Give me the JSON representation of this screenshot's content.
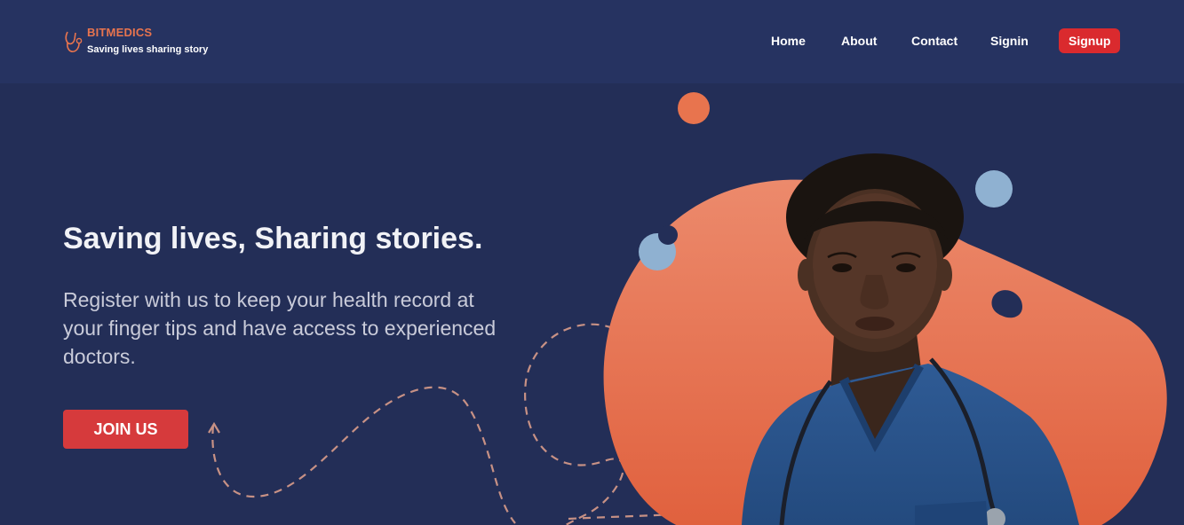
{
  "header": {
    "brand": "BITMEDICS",
    "tagline": "Saving lives sharing story",
    "logo_icon": "stethoscope-icon"
  },
  "nav": {
    "items": [
      {
        "label": "Home"
      },
      {
        "label": "About"
      },
      {
        "label": "Contact"
      },
      {
        "label": "Signin"
      }
    ],
    "signup_label": "Signup"
  },
  "hero": {
    "title": "Saving lives, Sharing stories.",
    "subtitle": "Register with us to keep your health record at your finger tips and have access to experienced doctors.",
    "cta_label": "JOIN US",
    "image": "doctor-portrait"
  },
  "colors": {
    "background": "#232e57",
    "header": "#263361",
    "accent": "#e8744e",
    "button": "#da2a2e",
    "blob": "#e87257",
    "dot_blue": "#8fb1d1"
  }
}
